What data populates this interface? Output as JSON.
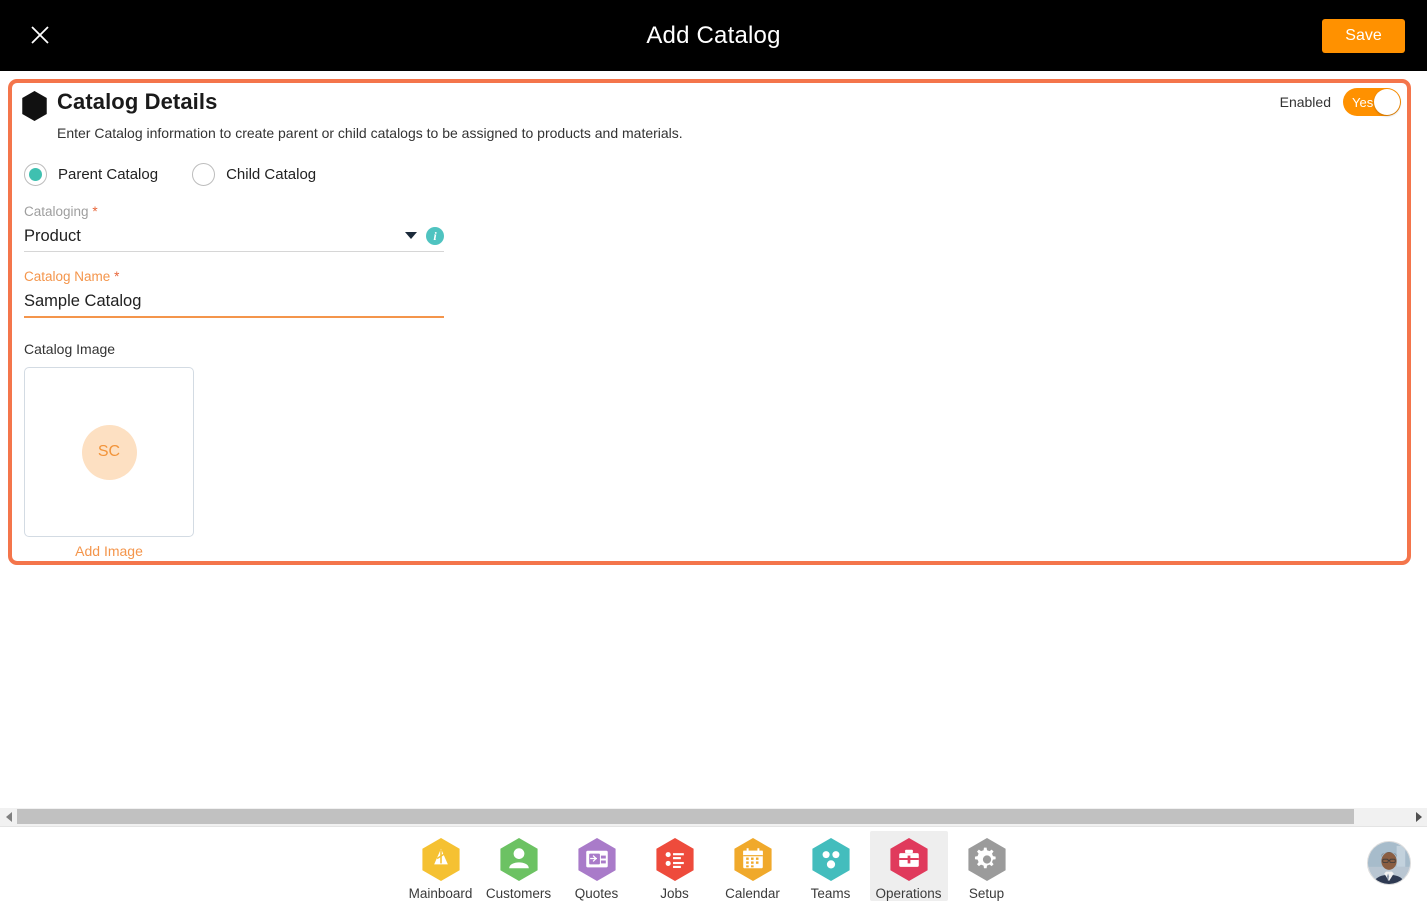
{
  "topbar": {
    "close_icon": "close-icon",
    "title": "Add Catalog",
    "save_label": "Save"
  },
  "card": {
    "hex_icon": "hexagon-icon",
    "title": "Catalog Details",
    "description": "Enter Catalog information to create parent or child catalogs to be assigned to products and materials.",
    "enabled_label": "Enabled",
    "toggle_value": "Yes",
    "radios": [
      {
        "label": "Parent Catalog",
        "selected": true
      },
      {
        "label": "Child Catalog",
        "selected": false
      }
    ],
    "fields": [
      {
        "label": "Cataloging",
        "required_marker": "*",
        "value": "Product",
        "type": "select",
        "focused": false,
        "info_icon": "info-icon",
        "info_glyph": "i",
        "caret_icon": "chevron-down-icon"
      },
      {
        "label": "Catalog Name",
        "required_marker": "*",
        "value": "Sample Catalog",
        "placeholder": "Catalog Name",
        "type": "text",
        "focused": true
      }
    ],
    "image_section": {
      "label": "Catalog Image",
      "avatar_initials": "SC",
      "add_image_label": "Add Image"
    }
  },
  "scrollbar": {
    "left_arrow_icon": "arrow-left-icon",
    "right_arrow_icon": "arrow-right-icon"
  },
  "bottomnav": {
    "items": [
      {
        "label": "Mainboard",
        "icon": "mainboard-icon",
        "color": "#F5C132",
        "active": false
      },
      {
        "label": "Customers",
        "icon": "customers-icon",
        "color": "#6CC263",
        "active": false
      },
      {
        "label": "Quotes",
        "icon": "quotes-icon",
        "color": "#A97BC9",
        "active": false
      },
      {
        "label": "Jobs",
        "icon": "jobs-icon",
        "color": "#EE4B3C",
        "active": false
      },
      {
        "label": "Calendar",
        "icon": "calendar-icon",
        "color": "#F0A92B",
        "active": false
      },
      {
        "label": "Teams",
        "icon": "teams-icon",
        "color": "#43BDBD",
        "active": false
      },
      {
        "label": "Operations",
        "icon": "operations-icon",
        "color": "#E03A5C",
        "active": true
      },
      {
        "label": "Setup",
        "icon": "setup-icon",
        "color": "#9B9B9B",
        "active": false
      }
    ],
    "avatar": "user-avatar"
  },
  "colors": {
    "accent_orange": "#FF9100",
    "card_border": "#F4754B",
    "teal": "#3FC0B0",
    "field_focus": "#F4954B"
  }
}
